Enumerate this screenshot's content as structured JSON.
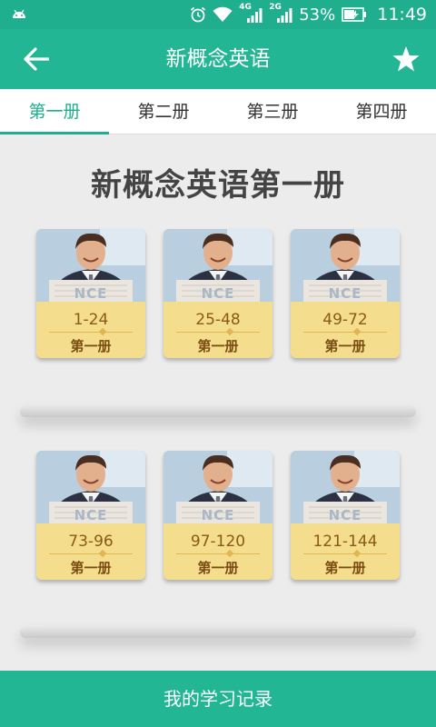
{
  "status_bar": {
    "net_4g": "4G",
    "net_2g": "2G",
    "battery": "53%",
    "time": "11:49",
    "icons": [
      "android-icon",
      "alarm-icon",
      "wifi-icon",
      "signal-4g-icon",
      "signal-2g-icon",
      "battery-icon"
    ]
  },
  "app_bar": {
    "title": "新概念英语",
    "back_icon": "arrow-left-icon",
    "favorite_icon": "star-icon"
  },
  "tabs": [
    {
      "label": "第一册",
      "active": true
    },
    {
      "label": "第二册",
      "active": false
    },
    {
      "label": "第三册",
      "active": false
    },
    {
      "label": "第四册",
      "active": false
    }
  ],
  "book_title": "新概念英语第一册",
  "books": [
    {
      "range": "1-24",
      "volume": "第一册",
      "brand": "NCE"
    },
    {
      "range": "25-48",
      "volume": "第一册",
      "brand": "NCE"
    },
    {
      "range": "49-72",
      "volume": "第一册",
      "brand": "NCE"
    },
    {
      "range": "73-96",
      "volume": "第一册",
      "brand": "NCE"
    },
    {
      "range": "97-120",
      "volume": "第一册",
      "brand": "NCE"
    },
    {
      "range": "121-144",
      "volume": "第一册",
      "brand": "NCE"
    }
  ],
  "bottom_bar": {
    "label": "我的学习记录"
  },
  "colors": {
    "primary": "#22b695",
    "status_bar": "#1fae8e",
    "active_tab": "#1fae8e",
    "book_label": "#f5dd8e",
    "background": "#ececec"
  }
}
